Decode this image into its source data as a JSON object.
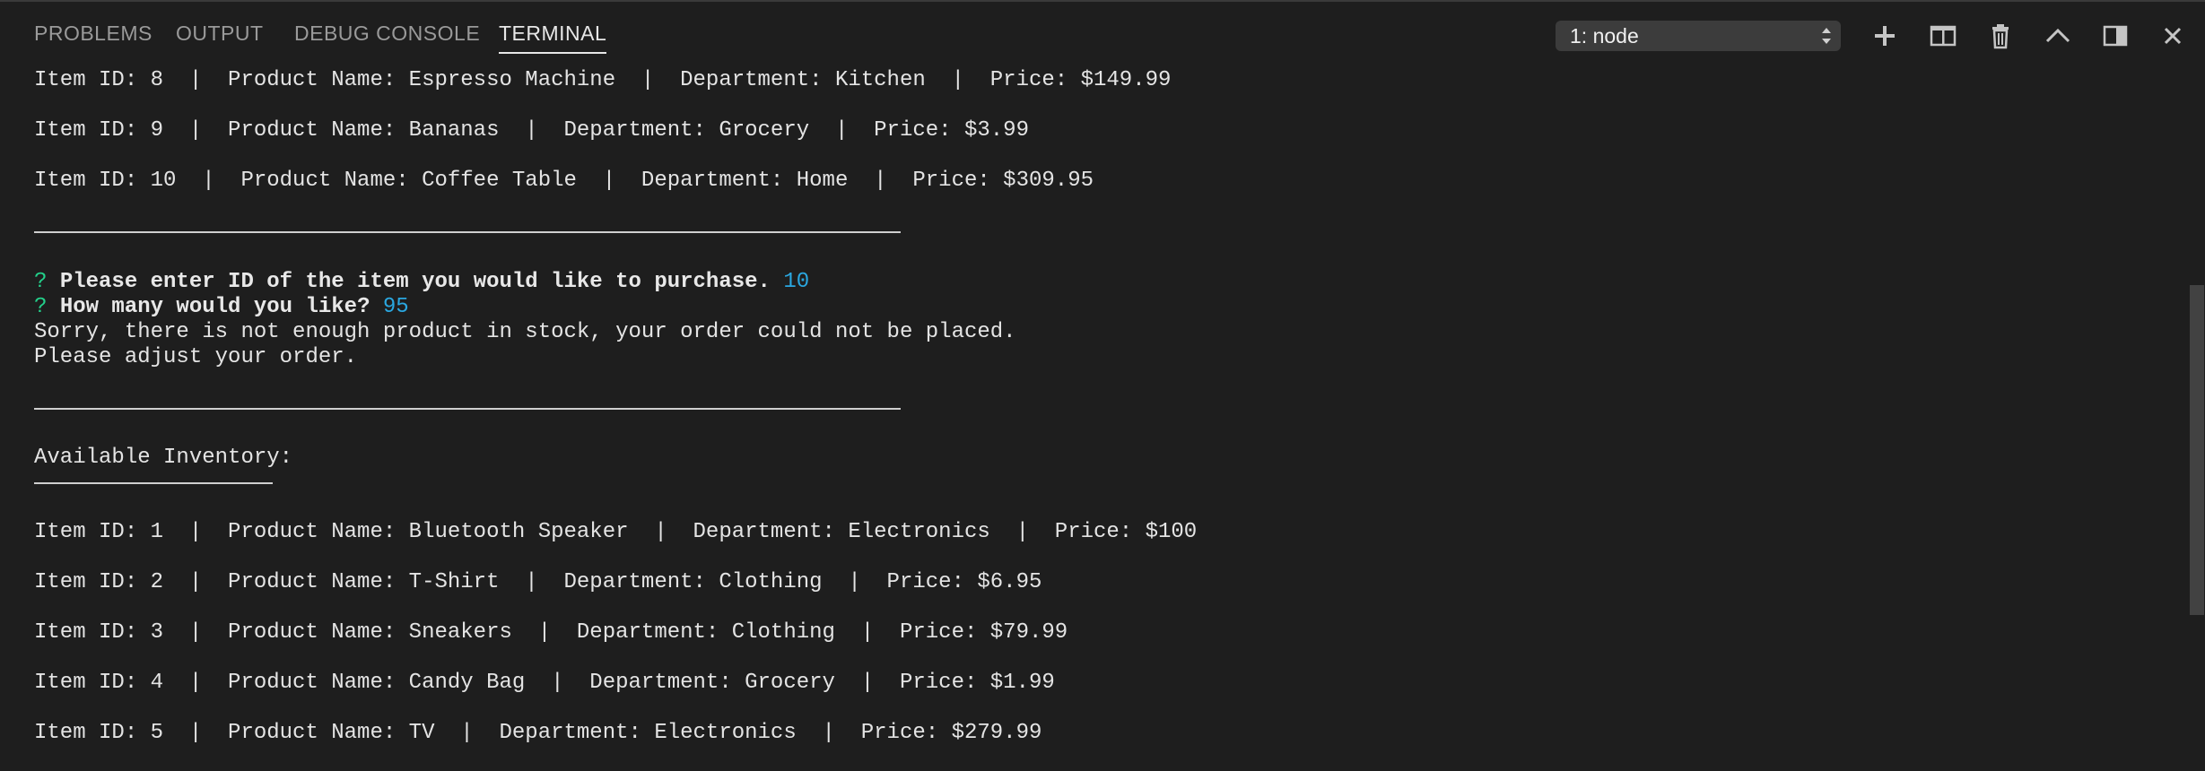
{
  "panel": {
    "tabs": [
      {
        "label": "PROBLEMS",
        "active": false
      },
      {
        "label": "OUTPUT",
        "active": false
      },
      {
        "label": "DEBUG CONSOLE",
        "active": false
      },
      {
        "label": "TERMINAL",
        "active": true
      }
    ],
    "terminal_select": {
      "value": "1: node"
    },
    "tools": {
      "new_terminal": "plus-icon",
      "split_terminal": "split-icon",
      "kill_terminal": "trash-icon",
      "maximize_panel": "chevron-up-icon",
      "toggle_panel_position": "panel-layout-icon",
      "close_panel": "close-icon"
    }
  },
  "terminal": {
    "items_top": [
      "Item ID: 8  |  Product Name: Espresso Machine  |  Department: Kitchen  |  Price: $149.99",
      "Item ID: 9  |  Product Name: Bananas  |  Department: Grocery  |  Price: $3.99",
      "Item ID: 10  |  Product Name: Coffee Table  |  Department: Home  |  Price: $309.95"
    ],
    "prompts": [
      {
        "mark": "?",
        "question": "Please enter ID of the item you would like to purchase.",
        "answer": "10"
      },
      {
        "mark": "?",
        "question": "How many would you like?",
        "answer": "95"
      }
    ],
    "messages": [
      "Sorry, there is not enough product in stock, your order could not be placed.",
      "Please adjust your order."
    ],
    "inventory_heading": "Available Inventory:",
    "items_bottom": [
      "Item ID: 1  |  Product Name: Bluetooth Speaker  |  Department: Electronics  |  Price: $100",
      "Item ID: 2  |  Product Name: T-Shirt  |  Department: Clothing  |  Price: $6.95",
      "Item ID: 3  |  Product Name: Sneakers  |  Department: Clothing  |  Price: $79.99",
      "Item ID: 4  |  Product Name: Candy Bag  |  Department: Grocery  |  Price: $1.99",
      "Item ID: 5  |  Product Name: TV  |  Department: Electronics  |  Price: $279.99"
    ]
  },
  "colors": {
    "background": "#1e1e1e",
    "prompt_mark": "#23d18b",
    "answer": "#2aa7e0",
    "text": "#e4e4e4"
  }
}
